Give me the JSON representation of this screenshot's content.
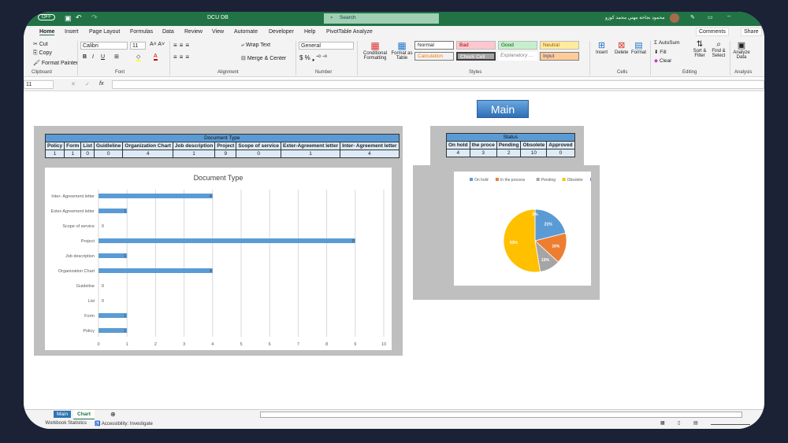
{
  "title_bar": {
    "autosave": "OFF",
    "file": "DCU DB",
    "search_placeholder": "Search",
    "user": "محمود نجاحة مهني محمد كوزو"
  },
  "tabs": [
    "Home",
    "Insert",
    "Page Layout",
    "Formulas",
    "Data",
    "Review",
    "View",
    "Automate",
    "Developer",
    "Help",
    "PivotTable Analyze"
  ],
  "ribbon": {
    "cut": "Cut",
    "copy": "Copy",
    "format_painter": "Format Painter",
    "clipboard": "Clipboard",
    "font_name": "Calibri",
    "font_size": "11",
    "font": "Font",
    "wrap_text": "Wrap Text",
    "merge_center": "Merge & Center",
    "alignment": "Alignment",
    "number_format": "General",
    "number": "Number",
    "conditional": "Conditional Formatting",
    "format_table": "Format as Table",
    "styles_label": "Styles",
    "styles": {
      "normal": "Normal",
      "bad": "Bad",
      "good": "Good",
      "neutral": "Neutral",
      "calculation": "Calculation",
      "check_cell": "Check Cell",
      "explanatory": "Explanatory ...",
      "input": "Input"
    },
    "insert": "Insert",
    "delete": "Delete",
    "format": "Format",
    "cells": "Cells",
    "autosum": "AutoSum",
    "fill": "Fill",
    "clear": "Clear",
    "sort_filter": "Sort & Filter",
    "find_select": "Find & Select",
    "editing": "Editing",
    "analyze": "Analyze Data",
    "analysis": "Analysis",
    "comments": "Comments",
    "share": "Share"
  },
  "formula_bar": {
    "name_box": "11",
    "fx": "fx",
    "value": ""
  },
  "main_button": "Main",
  "doc_table": {
    "title": "Document Type",
    "headers": [
      "Policy",
      "Form",
      "List",
      "Guidleline",
      "Organization Chart",
      "Job description",
      "Project",
      "Scope of service",
      "Exter-Agreement letter",
      "Inter- Agreement letter"
    ],
    "values": [
      "1",
      "1",
      "0",
      "0",
      "4",
      "1",
      "9",
      "0",
      "1",
      "4"
    ]
  },
  "status_table": {
    "title": "Status",
    "headers": [
      "On hold",
      "the proce",
      "Pending",
      "Obsolete",
      "Approved"
    ],
    "values": [
      "4",
      "3",
      "2",
      "10",
      "0"
    ]
  },
  "chart_data": [
    {
      "type": "bar",
      "orientation": "horizontal",
      "title": "Document Type",
      "categories": [
        "Inter- Agreement letter",
        "Exter-Agreement letter",
        "Scope of service",
        "Project",
        "Job description",
        "Organization Chart",
        "Guideline",
        "List",
        "Form",
        "Policy"
      ],
      "values": [
        4,
        1,
        0,
        9,
        1,
        4,
        0,
        0,
        1,
        1
      ],
      "xlim": [
        0,
        10
      ],
      "xticks": [
        "0",
        "1",
        "2",
        "3",
        "4",
        "5",
        "6",
        "7",
        "8",
        "9",
        "10"
      ],
      "grid": true,
      "color": "#5b9bd5"
    },
    {
      "type": "pie",
      "legend": [
        "On hold",
        "In the process",
        "Pending",
        "Obsolete",
        "Approved"
      ],
      "values": [
        4,
        3,
        2,
        10,
        0
      ],
      "labels": [
        "21%",
        "16%",
        "10%",
        "53%",
        "0%"
      ],
      "colors": [
        "#5b9bd5",
        "#ed7d31",
        "#a5a5a5",
        "#ffc000",
        "#4472c4"
      ],
      "legend_position": "top"
    }
  ],
  "sheet_tabs": [
    "Main",
    "Chart"
  ],
  "status_bar": {
    "stats": "Workbook Statistics",
    "accessibility": "Accessibility: Investigate"
  }
}
